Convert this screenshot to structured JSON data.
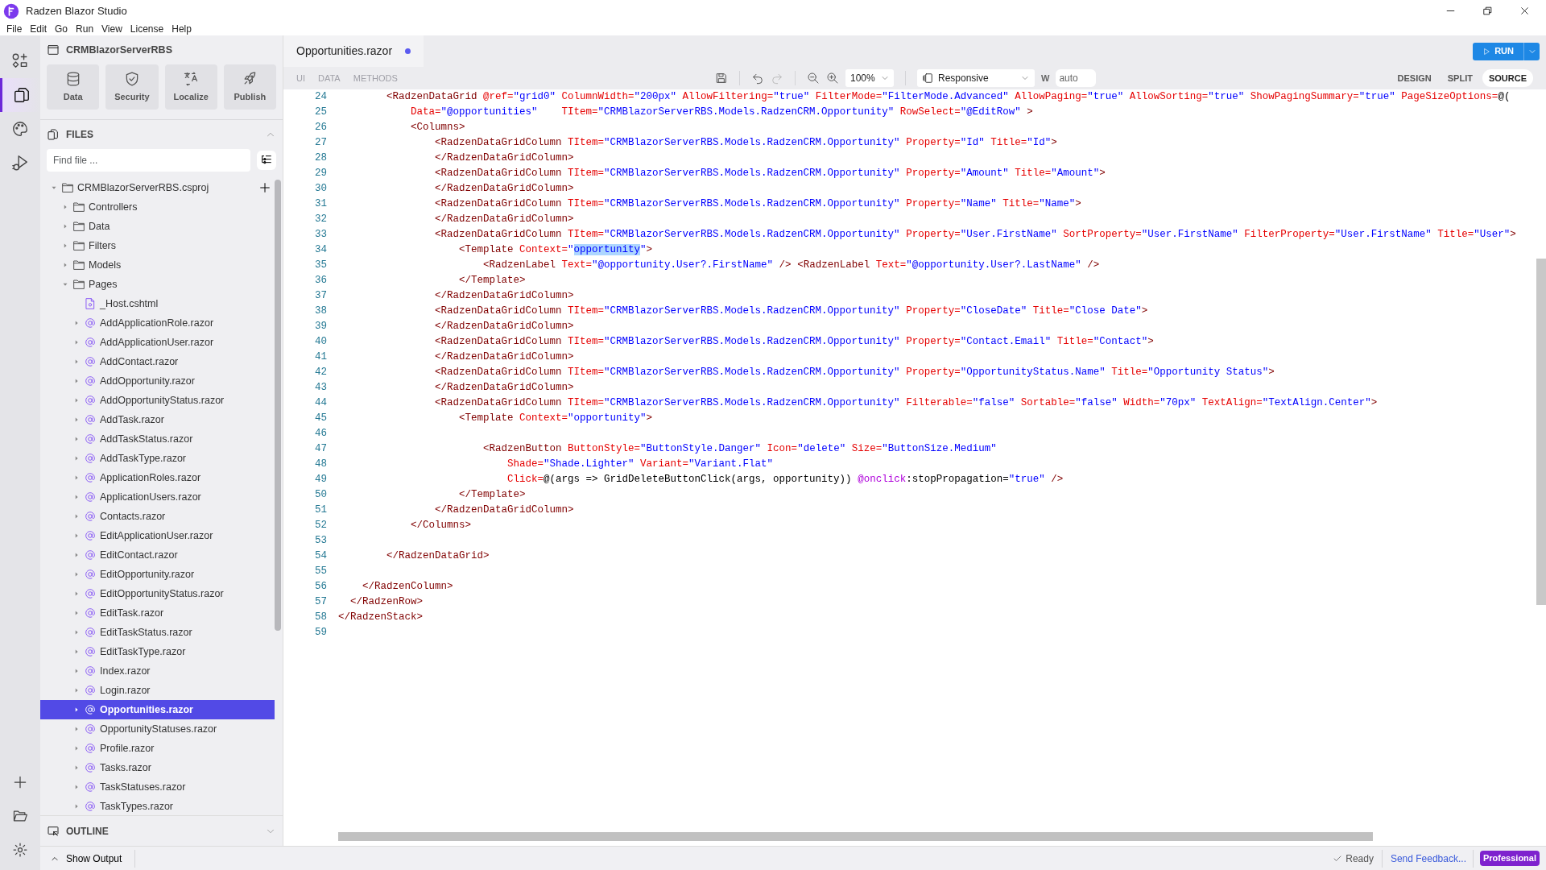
{
  "app": {
    "title": "Radzen Blazor Studio"
  },
  "menu": [
    "File",
    "Edit",
    "Go",
    "Run",
    "View",
    "License",
    "Help"
  ],
  "activity_bar": [
    {
      "kind": "components",
      "selected": false
    },
    {
      "kind": "files",
      "selected": true
    },
    {
      "kind": "themes",
      "selected": false
    },
    {
      "kind": "debug",
      "selected": false
    }
  ],
  "project": {
    "name": "CRMBlazorServerRBS"
  },
  "tools": [
    {
      "kind": "data",
      "label": "Data"
    },
    {
      "kind": "security",
      "label": "Security"
    },
    {
      "kind": "localize",
      "label": "Localize"
    },
    {
      "kind": "publish",
      "label": "Publish"
    }
  ],
  "files_panel": {
    "title": "FILES",
    "expanded": true,
    "search": {
      "placeholder": "Find file ..."
    }
  },
  "tree": [
    {
      "kind": "project",
      "label": "CRMBlazorServerRBS.csproj",
      "expanded": true,
      "selected": false,
      "children": [
        {
          "kind": "folder",
          "label": "Controllers",
          "expanded": false,
          "selected": false
        },
        {
          "kind": "folder",
          "label": "Data",
          "expanded": false,
          "selected": false
        },
        {
          "kind": "folder",
          "label": "Filters",
          "expanded": false,
          "selected": false
        },
        {
          "kind": "folder",
          "label": "Models",
          "expanded": false,
          "selected": false
        },
        {
          "kind": "folder",
          "label": "Pages",
          "expanded": true,
          "selected": false,
          "children": [
            {
              "kind": "cshtml",
              "label": "_Host.cshtml",
              "selected": false
            },
            {
              "kind": "razor",
              "label": "AddApplicationRole.razor",
              "expanded": false,
              "selected": false
            },
            {
              "kind": "razor",
              "label": "AddApplicationUser.razor",
              "expanded": false,
              "selected": false
            },
            {
              "kind": "razor",
              "label": "AddContact.razor",
              "expanded": false,
              "selected": false
            },
            {
              "kind": "razor",
              "label": "AddOpportunity.razor",
              "expanded": false,
              "selected": false
            },
            {
              "kind": "razor",
              "label": "AddOpportunityStatus.razor",
              "expanded": false,
              "selected": false
            },
            {
              "kind": "razor",
              "label": "AddTask.razor",
              "expanded": false,
              "selected": false
            },
            {
              "kind": "razor",
              "label": "AddTaskStatus.razor",
              "expanded": false,
              "selected": false
            },
            {
              "kind": "razor",
              "label": "AddTaskType.razor",
              "expanded": false,
              "selected": false
            },
            {
              "kind": "razor",
              "label": "ApplicationRoles.razor",
              "expanded": false,
              "selected": false
            },
            {
              "kind": "razor",
              "label": "ApplicationUsers.razor",
              "expanded": false,
              "selected": false
            },
            {
              "kind": "razor",
              "label": "Contacts.razor",
              "expanded": false,
              "selected": false
            },
            {
              "kind": "razor",
              "label": "EditApplicationUser.razor",
              "expanded": false,
              "selected": false
            },
            {
              "kind": "razor",
              "label": "EditContact.razor",
              "expanded": false,
              "selected": false
            },
            {
              "kind": "razor",
              "label": "EditOpportunity.razor",
              "expanded": false,
              "selected": false
            },
            {
              "kind": "razor",
              "label": "EditOpportunityStatus.razor",
              "expanded": false,
              "selected": false
            },
            {
              "kind": "razor",
              "label": "EditTask.razor",
              "expanded": false,
              "selected": false
            },
            {
              "kind": "razor",
              "label": "EditTaskStatus.razor",
              "expanded": false,
              "selected": false
            },
            {
              "kind": "razor",
              "label": "EditTaskType.razor",
              "expanded": false,
              "selected": false
            },
            {
              "kind": "razor",
              "label": "Index.razor",
              "expanded": false,
              "selected": false
            },
            {
              "kind": "razor",
              "label": "Login.razor",
              "expanded": false,
              "selected": false
            },
            {
              "kind": "razor",
              "label": "Opportunities.razor",
              "expanded": false,
              "selected": true
            },
            {
              "kind": "razor",
              "label": "OpportunityStatuses.razor",
              "expanded": false,
              "selected": false
            },
            {
              "kind": "razor",
              "label": "Profile.razor",
              "expanded": false,
              "selected": false
            },
            {
              "kind": "razor",
              "label": "Tasks.razor",
              "expanded": false,
              "selected": false
            },
            {
              "kind": "razor",
              "label": "TaskStatuses.razor",
              "expanded": false,
              "selected": false
            },
            {
              "kind": "razor",
              "label": "TaskTypes.razor",
              "expanded": false,
              "selected": false
            }
          ]
        }
      ]
    }
  ],
  "outline": {
    "title": "OUTLINE",
    "expanded": false
  },
  "editor_tab": {
    "label": "Opportunities.razor",
    "modified": true
  },
  "run_button": {
    "label": "RUN"
  },
  "toolbar": {
    "tabs": [
      {
        "label": "UI",
        "disabled": true
      },
      {
        "label": "DATA",
        "disabled": true
      },
      {
        "label": "METHODS",
        "disabled": true
      }
    ],
    "zoom": "100%",
    "device": "Responsive",
    "width_label": "W",
    "width": "auto",
    "views": [
      {
        "label": "DESIGN",
        "selected": false
      },
      {
        "label": "SPLIT",
        "selected": false
      },
      {
        "label": "SOURCE",
        "selected": true
      }
    ]
  },
  "code": [
    {
      "number": "24",
      "tokens": [
        {
          "kind": "tag",
          "text": "        <RadzenDataGrid"
        },
        {
          "kind": "attr",
          "text": " @ref="
        },
        {
          "kind": "val",
          "text": "\"grid0\""
        },
        {
          "kind": "attr",
          "text": " ColumnWidth="
        },
        {
          "kind": "val",
          "text": "\"200px\""
        },
        {
          "kind": "attr",
          "text": " AllowFiltering="
        },
        {
          "kind": "val",
          "text": "\"true\""
        },
        {
          "kind": "attr",
          "text": " FilterMode="
        },
        {
          "kind": "val",
          "text": "\"FilterMode.Advanced\""
        },
        {
          "kind": "attr",
          "text": " AllowPaging="
        },
        {
          "kind": "val",
          "text": "\"true\""
        },
        {
          "kind": "attr",
          "text": " AllowSorting="
        },
        {
          "kind": "val",
          "text": "\"true\""
        },
        {
          "kind": "attr",
          "text": " ShowPagingSummary="
        },
        {
          "kind": "val",
          "text": "\"true\""
        },
        {
          "kind": "attr",
          "text": " PageSizeOptions="
        },
        {
          "kind": "plain",
          "text": "@("
        }
      ]
    },
    {
      "number": "25",
      "tokens": [
        {
          "kind": "attr",
          "text": "            Data="
        },
        {
          "kind": "val",
          "text": "\"@opportunities\""
        },
        {
          "kind": "attr",
          "text": "    TItem="
        },
        {
          "kind": "val",
          "text": "\"CRMBlazorServerRBS.Models.RadzenCRM.Opportunity\""
        },
        {
          "kind": "attr",
          "text": " RowSelect="
        },
        {
          "kind": "val",
          "text": "\"@EditRow\""
        },
        {
          "kind": "tag",
          "text": " >"
        }
      ]
    },
    {
      "number": "26",
      "tokens": [
        {
          "kind": "tag",
          "text": "            <Columns>"
        }
      ]
    },
    {
      "number": "27",
      "tokens": [
        {
          "kind": "tag",
          "text": "                <RadzenDataGridColumn"
        },
        {
          "kind": "attr",
          "text": " TItem="
        },
        {
          "kind": "val",
          "text": "\"CRMBlazorServerRBS.Models.RadzenCRM.Opportunity\""
        },
        {
          "kind": "attr",
          "text": " Property="
        },
        {
          "kind": "val",
          "text": "\"Id\""
        },
        {
          "kind": "attr",
          "text": " Title="
        },
        {
          "kind": "val",
          "text": "\"Id\""
        },
        {
          "kind": "tag",
          "text": ">"
        }
      ]
    },
    {
      "number": "28",
      "tokens": [
        {
          "kind": "tag",
          "text": "                </RadzenDataGridColumn>"
        }
      ]
    },
    {
      "number": "29",
      "tokens": [
        {
          "kind": "tag",
          "text": "                <RadzenDataGridColumn"
        },
        {
          "kind": "attr",
          "text": " TItem="
        },
        {
          "kind": "val",
          "text": "\"CRMBlazorServerRBS.Models.RadzenCRM.Opportunity\""
        },
        {
          "kind": "attr",
          "text": " Property="
        },
        {
          "kind": "val",
          "text": "\"Amount\""
        },
        {
          "kind": "attr",
          "text": " Title="
        },
        {
          "kind": "val",
          "text": "\"Amount\""
        },
        {
          "kind": "tag",
          "text": ">"
        }
      ]
    },
    {
      "number": "30",
      "tokens": [
        {
          "kind": "tag",
          "text": "                </RadzenDataGridColumn>"
        }
      ]
    },
    {
      "number": "31",
      "tokens": [
        {
          "kind": "tag",
          "text": "                <RadzenDataGridColumn"
        },
        {
          "kind": "attr",
          "text": " TItem="
        },
        {
          "kind": "val",
          "text": "\"CRMBlazorServerRBS.Models.RadzenCRM.Opportunity\""
        },
        {
          "kind": "attr",
          "text": " Property="
        },
        {
          "kind": "val",
          "text": "\"Name\""
        },
        {
          "kind": "attr",
          "text": " Title="
        },
        {
          "kind": "val",
          "text": "\"Name\""
        },
        {
          "kind": "tag",
          "text": ">"
        }
      ]
    },
    {
      "number": "32",
      "tokens": [
        {
          "kind": "tag",
          "text": "                </RadzenDataGridColumn>"
        }
      ]
    },
    {
      "number": "33",
      "tokens": [
        {
          "kind": "tag",
          "text": "                <RadzenDataGridColumn"
        },
        {
          "kind": "attr",
          "text": " TItem="
        },
        {
          "kind": "val",
          "text": "\"CRMBlazorServerRBS.Models.RadzenCRM.Opportunity\""
        },
        {
          "kind": "attr",
          "text": " Property="
        },
        {
          "kind": "val",
          "text": "\"User.FirstName\""
        },
        {
          "kind": "attr",
          "text": " SortProperty="
        },
        {
          "kind": "val",
          "text": "\"User.FirstName\""
        },
        {
          "kind": "attr",
          "text": " FilterProperty="
        },
        {
          "kind": "val",
          "text": "\"User.FirstName\""
        },
        {
          "kind": "attr",
          "text": " Title="
        },
        {
          "kind": "val",
          "text": "\"User\""
        },
        {
          "kind": "tag",
          "text": ">"
        }
      ]
    },
    {
      "number": "34",
      "tokens": [
        {
          "kind": "tag",
          "text": "                    <Template"
        },
        {
          "kind": "attr",
          "text": " Context="
        },
        {
          "kind": "val",
          "text": "\""
        },
        {
          "kind": "val",
          "text": "opportunity",
          "highlighted": true
        },
        {
          "kind": "val",
          "text": "\""
        },
        {
          "kind": "tag",
          "text": ">"
        }
      ]
    },
    {
      "number": "35",
      "tokens": [
        {
          "kind": "tag",
          "text": "                        <RadzenLabel"
        },
        {
          "kind": "attr",
          "text": " Text="
        },
        {
          "kind": "val",
          "text": "\"@opportunity.User?.FirstName\""
        },
        {
          "kind": "tag",
          "text": " />"
        },
        {
          "kind": "tag",
          "text": " <RadzenLabel"
        },
        {
          "kind": "attr",
          "text": " Text="
        },
        {
          "kind": "val",
          "text": "\"@opportunity.User?.LastName\""
        },
        {
          "kind": "tag",
          "text": " />"
        }
      ]
    },
    {
      "number": "36",
      "tokens": [
        {
          "kind": "tag",
          "text": "                    </Template>"
        }
      ]
    },
    {
      "number": "37",
      "tokens": [
        {
          "kind": "tag",
          "text": "                </RadzenDataGridColumn>"
        }
      ]
    },
    {
      "number": "38",
      "tokens": [
        {
          "kind": "tag",
          "text": "                <RadzenDataGridColumn"
        },
        {
          "kind": "attr",
          "text": " TItem="
        },
        {
          "kind": "val",
          "text": "\"CRMBlazorServerRBS.Models.RadzenCRM.Opportunity\""
        },
        {
          "kind": "attr",
          "text": " Property="
        },
        {
          "kind": "val",
          "text": "\"CloseDate\""
        },
        {
          "kind": "attr",
          "text": " Title="
        },
        {
          "kind": "val",
          "text": "\"Close Date\""
        },
        {
          "kind": "tag",
          "text": ">"
        }
      ]
    },
    {
      "number": "39",
      "tokens": [
        {
          "kind": "tag",
          "text": "                </RadzenDataGridColumn>"
        }
      ]
    },
    {
      "number": "40",
      "tokens": [
        {
          "kind": "tag",
          "text": "                <RadzenDataGridColumn"
        },
        {
          "kind": "attr",
          "text": " TItem="
        },
        {
          "kind": "val",
          "text": "\"CRMBlazorServerRBS.Models.RadzenCRM.Opportunity\""
        },
        {
          "kind": "attr",
          "text": " Property="
        },
        {
          "kind": "val",
          "text": "\"Contact.Email\""
        },
        {
          "kind": "attr",
          "text": " Title="
        },
        {
          "kind": "val",
          "text": "\"Contact\""
        },
        {
          "kind": "tag",
          "text": ">"
        }
      ]
    },
    {
      "number": "41",
      "tokens": [
        {
          "kind": "tag",
          "text": "                </RadzenDataGridColumn>"
        }
      ]
    },
    {
      "number": "42",
      "tokens": [
        {
          "kind": "tag",
          "text": "                <RadzenDataGridColumn"
        },
        {
          "kind": "attr",
          "text": " TItem="
        },
        {
          "kind": "val",
          "text": "\"CRMBlazorServerRBS.Models.RadzenCRM.Opportunity\""
        },
        {
          "kind": "attr",
          "text": " Property="
        },
        {
          "kind": "val",
          "text": "\"OpportunityStatus.Name\""
        },
        {
          "kind": "attr",
          "text": " Title="
        },
        {
          "kind": "val",
          "text": "\"Opportunity Status\""
        },
        {
          "kind": "tag",
          "text": ">"
        }
      ]
    },
    {
      "number": "43",
      "tokens": [
        {
          "kind": "tag",
          "text": "                </RadzenDataGridColumn>"
        }
      ]
    },
    {
      "number": "44",
      "tokens": [
        {
          "kind": "tag",
          "text": "                <RadzenDataGridColumn"
        },
        {
          "kind": "attr",
          "text": " TItem="
        },
        {
          "kind": "val",
          "text": "\"CRMBlazorServerRBS.Models.RadzenCRM.Opportunity\""
        },
        {
          "kind": "attr",
          "text": " Filterable="
        },
        {
          "kind": "val",
          "text": "\"false\""
        },
        {
          "kind": "attr",
          "text": " Sortable="
        },
        {
          "kind": "val",
          "text": "\"false\""
        },
        {
          "kind": "attr",
          "text": " Width="
        },
        {
          "kind": "val",
          "text": "\"70px\""
        },
        {
          "kind": "attr",
          "text": " TextAlign="
        },
        {
          "kind": "val",
          "text": "\"TextAlign.Center\""
        },
        {
          "kind": "tag",
          "text": ">"
        }
      ]
    },
    {
      "number": "45",
      "tokens": [
        {
          "kind": "tag",
          "text": "                    <Template"
        },
        {
          "kind": "attr",
          "text": " Context="
        },
        {
          "kind": "val",
          "text": "\"opportunity\""
        },
        {
          "kind": "tag",
          "text": ">"
        }
      ]
    },
    {
      "number": "46"
    },
    {
      "number": "47",
      "tokens": [
        {
          "kind": "tag",
          "text": "                        <RadzenButton"
        },
        {
          "kind": "attr",
          "text": " ButtonStyle="
        },
        {
          "kind": "val",
          "text": "\"ButtonStyle.Danger\""
        },
        {
          "kind": "attr",
          "text": " Icon="
        },
        {
          "kind": "val",
          "text": "\"delete\""
        },
        {
          "kind": "attr",
          "text": " Size="
        },
        {
          "kind": "val",
          "text": "\"ButtonSize.Medium\""
        }
      ]
    },
    {
      "number": "48",
      "tokens": [
        {
          "kind": "attr",
          "text": "                            Shade="
        },
        {
          "kind": "val",
          "text": "\"Shade.Lighter\""
        },
        {
          "kind": "attr",
          "text": " Variant="
        },
        {
          "kind": "val",
          "text": "\"Variant.Flat\""
        }
      ]
    },
    {
      "number": "49",
      "tokens": [
        {
          "kind": "attr",
          "text": "                            Click="
        },
        {
          "kind": "plain",
          "text": "@(args => GridDeleteButtonClick(args, opportunity)) "
        },
        {
          "kind": "razor",
          "text": "@onclick"
        },
        {
          "kind": "plain",
          "text": ":stopPropagation="
        },
        {
          "kind": "val",
          "text": "\"true\""
        },
        {
          "kind": "tag",
          "text": " />"
        }
      ]
    },
    {
      "number": "50",
      "tokens": [
        {
          "kind": "tag",
          "text": "                    </Template>"
        }
      ]
    },
    {
      "number": "51",
      "tokens": [
        {
          "kind": "tag",
          "text": "                </RadzenDataGridColumn>"
        }
      ]
    },
    {
      "number": "52",
      "tokens": [
        {
          "kind": "tag",
          "text": "            </Columns>"
        }
      ]
    },
    {
      "number": "53"
    },
    {
      "number": "54",
      "tokens": [
        {
          "kind": "tag",
          "text": "        </RadzenDataGrid>"
        }
      ]
    },
    {
      "number": "55"
    },
    {
      "number": "56",
      "tokens": [
        {
          "kind": "tag",
          "text": "    </RadzenColumn>"
        }
      ]
    },
    {
      "number": "57",
      "tokens": [
        {
          "kind": "tag",
          "text": "  </RadzenRow>"
        }
      ]
    },
    {
      "number": "58",
      "tokens": [
        {
          "kind": "tag",
          "text": "</RadzenStack>"
        }
      ]
    },
    {
      "number": "59"
    }
  ],
  "status_bar": {
    "output": "Show Output",
    "status": "Ready",
    "feedback": "Send Feedback...",
    "license": "Professional"
  }
}
